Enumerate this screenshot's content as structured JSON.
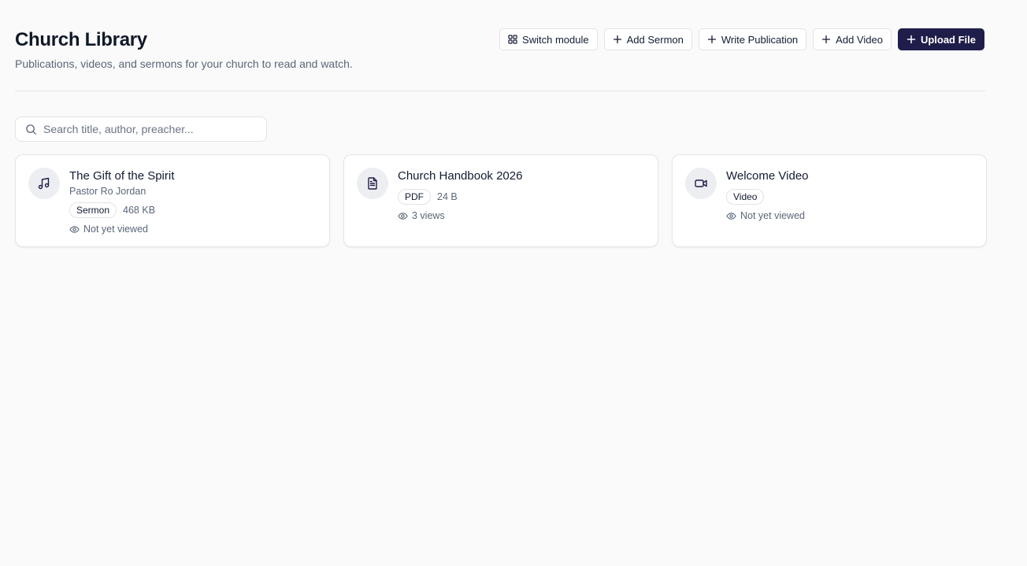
{
  "header": {
    "title": "Church Library",
    "subtitle": "Publications, videos, and sermons for your church to read and watch."
  },
  "actions": {
    "switch_module": "Switch module",
    "add_sermon": "Add Sermon",
    "write_publication": "Write Publication",
    "add_video": "Add Video",
    "upload_file": "Upload File"
  },
  "search": {
    "placeholder": "Search title, author, preacher..."
  },
  "items": [
    {
      "icon": "music-note-icon",
      "title": "The Gift of the Spirit",
      "author": "Pastor Ro Jordan",
      "badge": "Sermon",
      "size": "468 KB",
      "views": "Not yet viewed"
    },
    {
      "icon": "document-icon",
      "title": "Church Handbook 2026",
      "badge": "PDF",
      "size": "24 B",
      "views": "3 views"
    },
    {
      "icon": "video-camera-icon",
      "title": "Welcome Video",
      "badge": "Video",
      "views": "Not yet viewed"
    }
  ],
  "colors": {
    "primary": "#1f1d4a",
    "text": "#141b34",
    "muted": "#5b6679",
    "background": "#fafafa",
    "border": "#e1e3e8"
  }
}
